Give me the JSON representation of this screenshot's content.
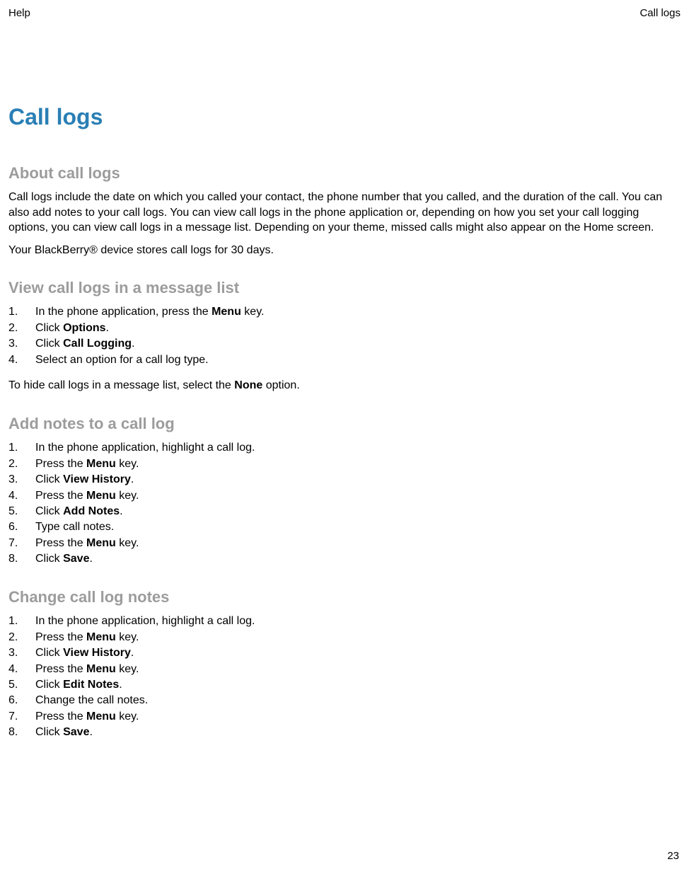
{
  "header": {
    "left": "Help",
    "right": "Call logs"
  },
  "title": "Call logs",
  "about": {
    "heading": "About call logs",
    "p1": "Call logs include the date on which you called your contact, the phone number that you called, and the duration of the call. You can also add notes to your call logs. You can view call logs in the phone application or, depending on how you set your call logging options, you can view call logs in a message list. Depending on your theme, missed calls might also appear on the Home screen.",
    "p2": "Your BlackBerry® device stores call logs for 30 days."
  },
  "view": {
    "heading": "View call logs in a message list",
    "steps": [
      {
        "pre": "In the phone application, press the ",
        "bold": "Menu",
        "post": " key."
      },
      {
        "pre": "Click ",
        "bold": "Options",
        "post": "."
      },
      {
        "pre": "Click ",
        "bold": "Call Logging",
        "post": "."
      },
      {
        "pre": "Select an option for a call log type.",
        "bold": "",
        "post": ""
      }
    ],
    "note_pre": "To hide call logs in a message list, select the ",
    "note_bold": "None",
    "note_post": " option."
  },
  "add": {
    "heading": "Add notes to a call log",
    "steps": [
      {
        "pre": "In the phone application, highlight a call log.",
        "bold": "",
        "post": ""
      },
      {
        "pre": "Press the ",
        "bold": "Menu",
        "post": " key."
      },
      {
        "pre": "Click ",
        "bold": "View History",
        "post": "."
      },
      {
        "pre": "Press the ",
        "bold": "Menu",
        "post": " key."
      },
      {
        "pre": "Click ",
        "bold": "Add Notes",
        "post": "."
      },
      {
        "pre": "Type call notes.",
        "bold": "",
        "post": ""
      },
      {
        "pre": "Press the ",
        "bold": "Menu",
        "post": " key."
      },
      {
        "pre": "Click ",
        "bold": "Save",
        "post": "."
      }
    ]
  },
  "change": {
    "heading": "Change call log notes",
    "steps": [
      {
        "pre": "In the phone application, highlight a call log.",
        "bold": "",
        "post": ""
      },
      {
        "pre": "Press the ",
        "bold": "Menu",
        "post": " key."
      },
      {
        "pre": "Click ",
        "bold": "View History",
        "post": "."
      },
      {
        "pre": "Press the ",
        "bold": "Menu",
        "post": " key."
      },
      {
        "pre": "Click ",
        "bold": "Edit Notes",
        "post": "."
      },
      {
        "pre": "Change the call notes.",
        "bold": "",
        "post": ""
      },
      {
        "pre": "Press the ",
        "bold": "Menu",
        "post": " key."
      },
      {
        "pre": "Click ",
        "bold": "Save",
        "post": "."
      }
    ]
  },
  "page_number": "23"
}
